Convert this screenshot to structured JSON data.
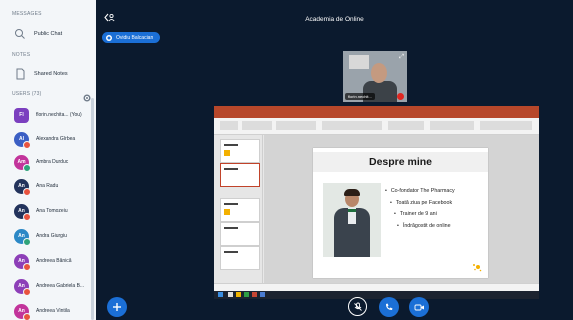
{
  "sidebar": {
    "messages_heading": "MESSAGES",
    "public_chat": "Public Chat",
    "notes_heading": "NOTES",
    "shared_notes": "Shared Notes",
    "users_heading": "USERS (73)",
    "users": [
      {
        "initials": "Fl",
        "name": "florin.nechita... (You)",
        "color": "#7b3fbf",
        "square": true,
        "badge": ""
      },
      {
        "initials": "Al",
        "name": "Alexandra Gîrbea",
        "color": "#3b5fc4",
        "square": false,
        "badge": "#e8533f"
      },
      {
        "initials": "Am",
        "name": "Ambra Durduc",
        "color": "#c2349b",
        "square": false,
        "badge": "#2fa37a"
      },
      {
        "initials": "An",
        "name": "Ana Radu",
        "color": "#23335c",
        "square": false,
        "badge": "#e8533f"
      },
      {
        "initials": "An",
        "name": "Ana Tomozeiu",
        "color": "#23335c",
        "square": false,
        "badge": "#e8533f"
      },
      {
        "initials": "An",
        "name": "Andra Giurgiu",
        "color": "#2b88c6",
        "square": false,
        "badge": "#2fa37a"
      },
      {
        "initials": "An",
        "name": "Andreea Bănică",
        "color": "#8d3fb8",
        "square": false,
        "badge": "#e8533f"
      },
      {
        "initials": "An",
        "name": "Andreea Gabriela B...",
        "color": "#8d3fb8",
        "square": false,
        "badge": "#e8533f"
      },
      {
        "initials": "An",
        "name": "Andreea Vintila",
        "color": "#c2349b",
        "square": false,
        "badge": "#e8533f"
      }
    ]
  },
  "main": {
    "title": "Academia de Online",
    "presenter": "Ovidiu Balcacian",
    "webcam_label": "florin.nechit...",
    "slide": {
      "title": "Despre mine",
      "bullets": [
        "Co-fondator The Pharmacy",
        "Toată ziua pe Facebook",
        "Trainer de 9 ani",
        "Îndrăgostit de online"
      ]
    }
  },
  "colors": {
    "accent": "#1b6fd6",
    "background": "#0b1a2e",
    "sidebar": "#f3f6f9",
    "ppt_brand": "#b7472a"
  }
}
